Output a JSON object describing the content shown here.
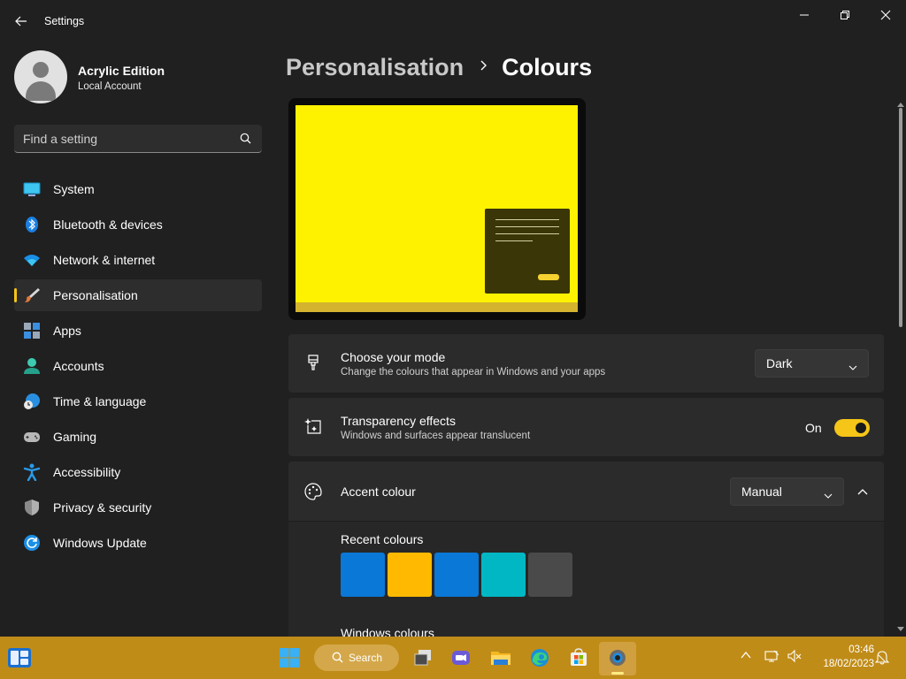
{
  "window": {
    "title": "Settings"
  },
  "user": {
    "name": "Acrylic Edition",
    "account_type": "Local Account"
  },
  "search": {
    "placeholder": "Find a setting"
  },
  "nav": {
    "items": [
      {
        "label": "System",
        "icon": "system-icon",
        "active": false
      },
      {
        "label": "Bluetooth & devices",
        "icon": "bluetooth-icon",
        "active": false
      },
      {
        "label": "Network & internet",
        "icon": "wifi-icon",
        "active": false
      },
      {
        "label": "Personalisation",
        "icon": "paintbrush-icon",
        "active": true
      },
      {
        "label": "Apps",
        "icon": "apps-icon",
        "active": false
      },
      {
        "label": "Accounts",
        "icon": "person-icon",
        "active": false
      },
      {
        "label": "Time & language",
        "icon": "globe-clock-icon",
        "active": false
      },
      {
        "label": "Gaming",
        "icon": "gamepad-icon",
        "active": false
      },
      {
        "label": "Accessibility",
        "icon": "accessibility-icon",
        "active": false
      },
      {
        "label": "Privacy & security",
        "icon": "shield-icon",
        "active": false
      },
      {
        "label": "Windows Update",
        "icon": "update-icon",
        "active": false
      }
    ]
  },
  "breadcrumb": {
    "parent": "Personalisation",
    "current": "Colours"
  },
  "mode_card": {
    "title": "Choose your mode",
    "subtitle": "Change the colours that appear in Windows and your apps",
    "value": "Dark"
  },
  "transparency_card": {
    "title": "Transparency effects",
    "subtitle": "Windows and surfaces appear translucent",
    "state_label": "On"
  },
  "accent_card": {
    "title": "Accent colour",
    "value": "Manual",
    "recent_label": "Recent colours",
    "recent_colours": [
      "#0a78d7",
      "#ffb900",
      "#0a78d7",
      "#00b7c3",
      "#4a4a4a"
    ],
    "windows_colours_label": "Windows colours"
  },
  "colors": {
    "accent": "#f5c518",
    "taskbar": "#c08c18",
    "wallpaper": "#fff200"
  },
  "taskbar": {
    "search_label": "Search",
    "time": "03:46",
    "date": "18/02/2023"
  }
}
